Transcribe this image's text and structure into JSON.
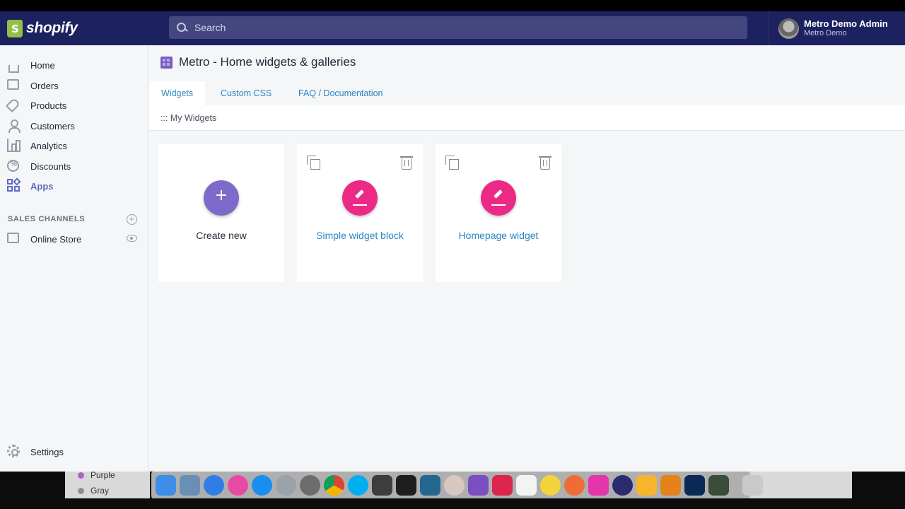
{
  "topbar": {
    "logo_text": "shopify",
    "search_placeholder": "Search",
    "user_name": "Metro Demo Admin",
    "user_store": "Metro Demo"
  },
  "sidebar": {
    "items": [
      {
        "label": "Home",
        "icon": "home-icon"
      },
      {
        "label": "Orders",
        "icon": "orders-icon"
      },
      {
        "label": "Products",
        "icon": "tag-icon"
      },
      {
        "label": "Customers",
        "icon": "person-icon"
      },
      {
        "label": "Analytics",
        "icon": "bar-chart-icon"
      },
      {
        "label": "Discounts",
        "icon": "discount-icon"
      },
      {
        "label": "Apps",
        "icon": "apps-icon",
        "active": true
      }
    ],
    "section_title": "SALES CHANNELS",
    "channels": [
      {
        "label": "Online Store",
        "icon": "store-icon"
      }
    ],
    "settings_label": "Settings"
  },
  "main": {
    "page_title": "Metro - Home widgets & galleries",
    "tabs": [
      {
        "label": "Widgets",
        "active": true
      },
      {
        "label": "Custom CSS"
      },
      {
        "label": "FAQ / Documentation"
      }
    ],
    "breadcrumb": "::: My Widgets",
    "cards": [
      {
        "label": "Create new",
        "type": "create"
      },
      {
        "label": "Simple widget block",
        "type": "widget"
      },
      {
        "label": "Homepage widget",
        "type": "widget"
      }
    ]
  },
  "finder": {
    "colors": [
      {
        "label": "Purple",
        "color": "#b05fc9"
      },
      {
        "label": "Gray",
        "color": "#8e8e8e"
      }
    ]
  },
  "dock": {
    "apps": [
      "finder-icon",
      "preview-icon",
      "safari-icon",
      "itunes-icon",
      "app-store-icon",
      "launchpad-icon",
      "system-preferences-icon",
      "chrome-icon",
      "skype-icon",
      "sublime-icon",
      "terminal-icon",
      "vscode-icon",
      "color-picker-icon",
      "dash-icon",
      "todoist-icon",
      "textedit-icon",
      "lemon-icon",
      "postman-icon",
      "graphql-icon",
      "moon-icon",
      "sketch-icon",
      "sublime-alt-icon",
      "photoshop-icon",
      "screen-recorder-icon",
      "trash-icon"
    ]
  },
  "colors": {
    "topbar": "#1c2260",
    "accent": "#5c6ac4",
    "link": "#2e86c1",
    "fab_create": "#7e6bc9",
    "fab_edit": "#ec2a85"
  }
}
